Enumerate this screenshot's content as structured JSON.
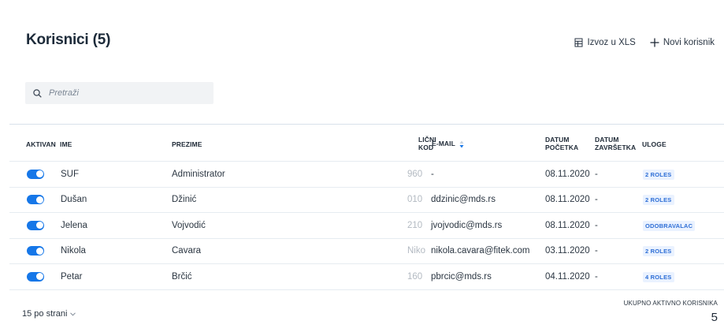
{
  "page": {
    "title": "Korisnici (5)"
  },
  "toolbar": {
    "export_label": "Izvoz u XLS",
    "new_user_label": "Novi korisnik"
  },
  "search": {
    "placeholder": "Pretraži",
    "value": ""
  },
  "table": {
    "headers": {
      "active": "AKTIVAN",
      "first_name": "IME",
      "last_name": "PREZIME",
      "id_code_line1": "LIČNI",
      "id_code_line2": "KOD",
      "email": "E-MAIL",
      "start_date_line1": "DATUM",
      "start_date_line2": "POČETKA",
      "end_date_line1": "DATUM",
      "end_date_line2": "ZAVRŠETKA",
      "roles": "ULOGE"
    },
    "rows": [
      {
        "active": true,
        "first_name": "SUF",
        "last_name": "Administrator",
        "id_code": "960",
        "email": "-",
        "start_date": "08.11.2020",
        "end_date": "-",
        "roles": "2 ROLES"
      },
      {
        "active": true,
        "first_name": "Dušan",
        "last_name": "Džinić",
        "id_code": "010",
        "email": "ddzinic@mds.rs",
        "start_date": "08.11.2020",
        "end_date": "-",
        "roles": "2 ROLES"
      },
      {
        "active": true,
        "first_name": "Jelena",
        "last_name": "Vojvodić",
        "id_code": "210",
        "email": "jvojvodic@mds.rs",
        "start_date": "08.11.2020",
        "end_date": "-",
        "roles": "ODOBRAVALAC"
      },
      {
        "active": true,
        "first_name": "Nikola",
        "last_name": "Cavara",
        "id_code": "Niko",
        "email": "nikola.cavara@fitek.com",
        "start_date": "03.11.2020",
        "end_date": "-",
        "roles": "2 ROLES"
      },
      {
        "active": true,
        "first_name": "Petar",
        "last_name": "Brčić",
        "id_code": "160",
        "email": "pbrcic@mds.rs",
        "start_date": "04.11.2020",
        "end_date": "-",
        "roles": "4 ROLES"
      }
    ]
  },
  "footer": {
    "per_page_label": "15 po strani",
    "total_active_label": "UKUPNO AKTIVNO KORISNIKA",
    "total_active_count": "5"
  },
  "colors": {
    "accent": "#1677e8",
    "badge_text": "#2f6fd6",
    "badge_bg": "#eaf2ff"
  }
}
